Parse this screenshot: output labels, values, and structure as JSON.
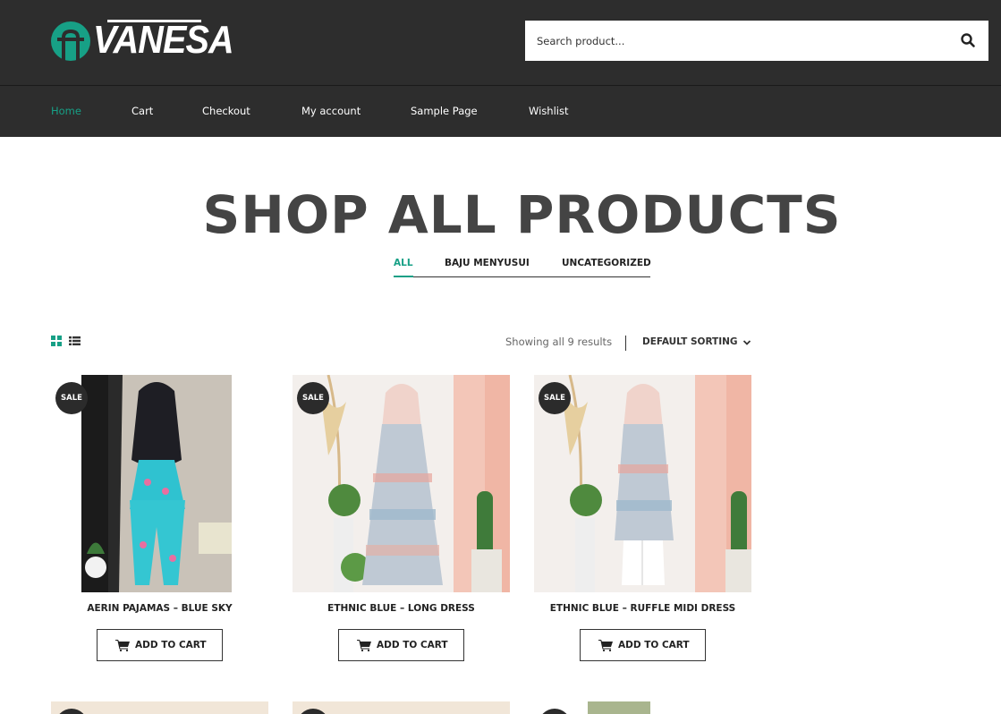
{
  "brand": {
    "name": "VANESA",
    "accent": "#17a086",
    "header_bg": "#2d2d2d"
  },
  "search": {
    "placeholder": "Search product..."
  },
  "nav": {
    "items": [
      {
        "label": "Home",
        "active": true
      },
      {
        "label": "Cart",
        "active": false
      },
      {
        "label": "Checkout",
        "active": false
      },
      {
        "label": "My account",
        "active": false
      },
      {
        "label": "Sample Page",
        "active": false
      },
      {
        "label": "Wishlist",
        "active": false
      }
    ]
  },
  "page": {
    "title": "SHOP ALL PRODUCTS"
  },
  "categories": [
    {
      "label": "ALL",
      "active": true
    },
    {
      "label": "BAJU MENYUSUI",
      "active": false
    },
    {
      "label": "UNCATEGORIZED",
      "active": false
    }
  ],
  "toolbar": {
    "results": "Showing all 9 results",
    "sorting": "DEFAULT SORTING"
  },
  "products": [
    {
      "name": "AERIN PAJAMAS – BLUE SKY",
      "badge": "SALE",
      "button": "ADD TO CART"
    },
    {
      "name": "ETHNIC BLUE – LONG DRESS",
      "badge": "SALE",
      "button": "ADD TO CART"
    },
    {
      "name": "ETHNIC BLUE – RUFFLE MIDI DRESS",
      "badge": "SALE",
      "button": "ADD TO CART"
    }
  ]
}
